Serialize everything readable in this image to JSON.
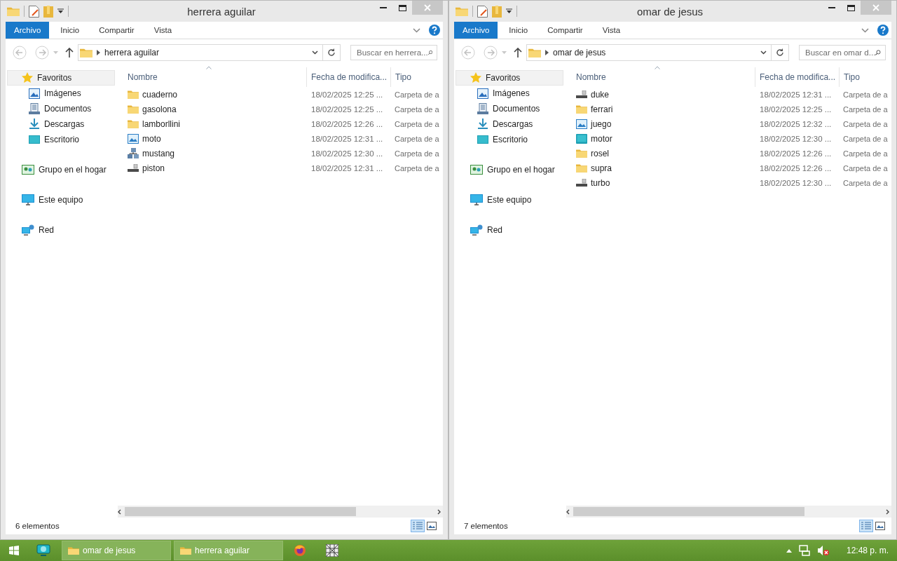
{
  "windows": [
    {
      "title": "herrera aguilar",
      "ribbon_tabs": [
        {
          "label": "Archivo",
          "selected": true
        },
        {
          "label": "Inicio",
          "selected": false
        },
        {
          "label": "Compartir",
          "selected": false
        },
        {
          "label": "Vista",
          "selected": false
        }
      ],
      "address": "herrera aguilar",
      "search_placeholder": "Buscar en herrera...",
      "nav": [
        {
          "label": "Favoritos",
          "kind": "star",
          "selected": true,
          "children": [
            {
              "label": "Imágenes",
              "kind": "pictures"
            },
            {
              "label": "Documentos",
              "kind": "documents"
            },
            {
              "label": "Descargas",
              "kind": "downloads"
            },
            {
              "label": "Escritorio",
              "kind": "desktop"
            }
          ]
        },
        {
          "label": "Grupo en el hogar",
          "kind": "homegroup",
          "selected": false
        },
        {
          "label": "Este equipo",
          "kind": "computer",
          "selected": false
        },
        {
          "label": "Red",
          "kind": "network",
          "selected": false
        }
      ],
      "columns": [
        "Nombre",
        "Fecha de modifica...",
        "Tipo"
      ],
      "files": [
        {
          "name": "cuaderno",
          "kind": "folder",
          "date": "18/02/2025 12:25 ...",
          "type": "Carpeta de a"
        },
        {
          "name": "gasolona",
          "kind": "folder",
          "date": "18/02/2025 12:25 ...",
          "type": "Carpeta de a"
        },
        {
          "name": "lamborllini",
          "kind": "folder",
          "date": "18/02/2025 12:26 ...",
          "type": "Carpeta de a"
        },
        {
          "name": "moto",
          "kind": "picture",
          "date": "18/02/2025 12:31 ...",
          "type": "Carpeta de a"
        },
        {
          "name": "mustang",
          "kind": "network",
          "date": "18/02/2025 12:30 ...",
          "type": "Carpeta de a"
        },
        {
          "name": "piston",
          "kind": "drive",
          "date": "18/02/2025 12:31 ...",
          "type": "Carpeta de a"
        }
      ],
      "status": "6 elementos",
      "view_buttons": [
        {
          "kind": "details",
          "selected": true
        },
        {
          "kind": "tiles",
          "selected": false
        }
      ]
    },
    {
      "title": "omar de jesus",
      "ribbon_tabs": [
        {
          "label": "Archivo",
          "selected": true
        },
        {
          "label": "Inicio",
          "selected": false
        },
        {
          "label": "Compartir",
          "selected": false
        },
        {
          "label": "Vista",
          "selected": false
        }
      ],
      "address": "omar de jesus",
      "search_placeholder": "Buscar en omar d...",
      "nav": [
        {
          "label": "Favoritos",
          "kind": "star",
          "selected": true,
          "children": [
            {
              "label": "Imágenes",
              "kind": "pictures"
            },
            {
              "label": "Documentos",
              "kind": "documents"
            },
            {
              "label": "Descargas",
              "kind": "downloads"
            },
            {
              "label": "Escritorio",
              "kind": "desktop"
            }
          ]
        },
        {
          "label": "Grupo en el hogar",
          "kind": "homegroup",
          "selected": false
        },
        {
          "label": "Este equipo",
          "kind": "computer",
          "selected": false
        },
        {
          "label": "Red",
          "kind": "network",
          "selected": false
        }
      ],
      "columns": [
        "Nombre",
        "Fecha de modifica...",
        "Tipo"
      ],
      "files": [
        {
          "name": "duke",
          "kind": "drive",
          "date": "18/02/2025 12:31 ...",
          "type": "Carpeta de a"
        },
        {
          "name": "ferrari",
          "kind": "folder",
          "date": "18/02/2025 12:25 ...",
          "type": "Carpeta de a"
        },
        {
          "name": "juego",
          "kind": "picture",
          "date": "18/02/2025 12:32 ...",
          "type": "Carpeta de a"
        },
        {
          "name": "motor",
          "kind": "desktop",
          "date": "18/02/2025 12:30 ...",
          "type": "Carpeta de a"
        },
        {
          "name": "rosel",
          "kind": "folder",
          "date": "18/02/2025 12:26 ...",
          "type": "Carpeta de a"
        },
        {
          "name": "supra",
          "kind": "folder",
          "date": "18/02/2025 12:26 ...",
          "type": "Carpeta de a"
        },
        {
          "name": "turbo",
          "kind": "drive",
          "date": "18/02/2025 12:30 ...",
          "type": "Carpeta de a"
        }
      ],
      "status": "7 elementos",
      "view_buttons": [
        {
          "kind": "details",
          "selected": true
        },
        {
          "kind": "tiles",
          "selected": false
        }
      ]
    }
  ],
  "taskbar": {
    "items": [
      {
        "kind": "start"
      },
      {
        "kind": "app"
      },
      {
        "kind": "window",
        "label": "omar de jesus"
      },
      {
        "kind": "window",
        "label": "herrera aguilar"
      },
      {
        "kind": "browser"
      },
      {
        "kind": "grid"
      }
    ],
    "tray": [
      {
        "kind": "caret"
      },
      {
        "kind": "network"
      },
      {
        "kind": "volume-muted"
      }
    ],
    "clock": "12:48 p. m."
  }
}
